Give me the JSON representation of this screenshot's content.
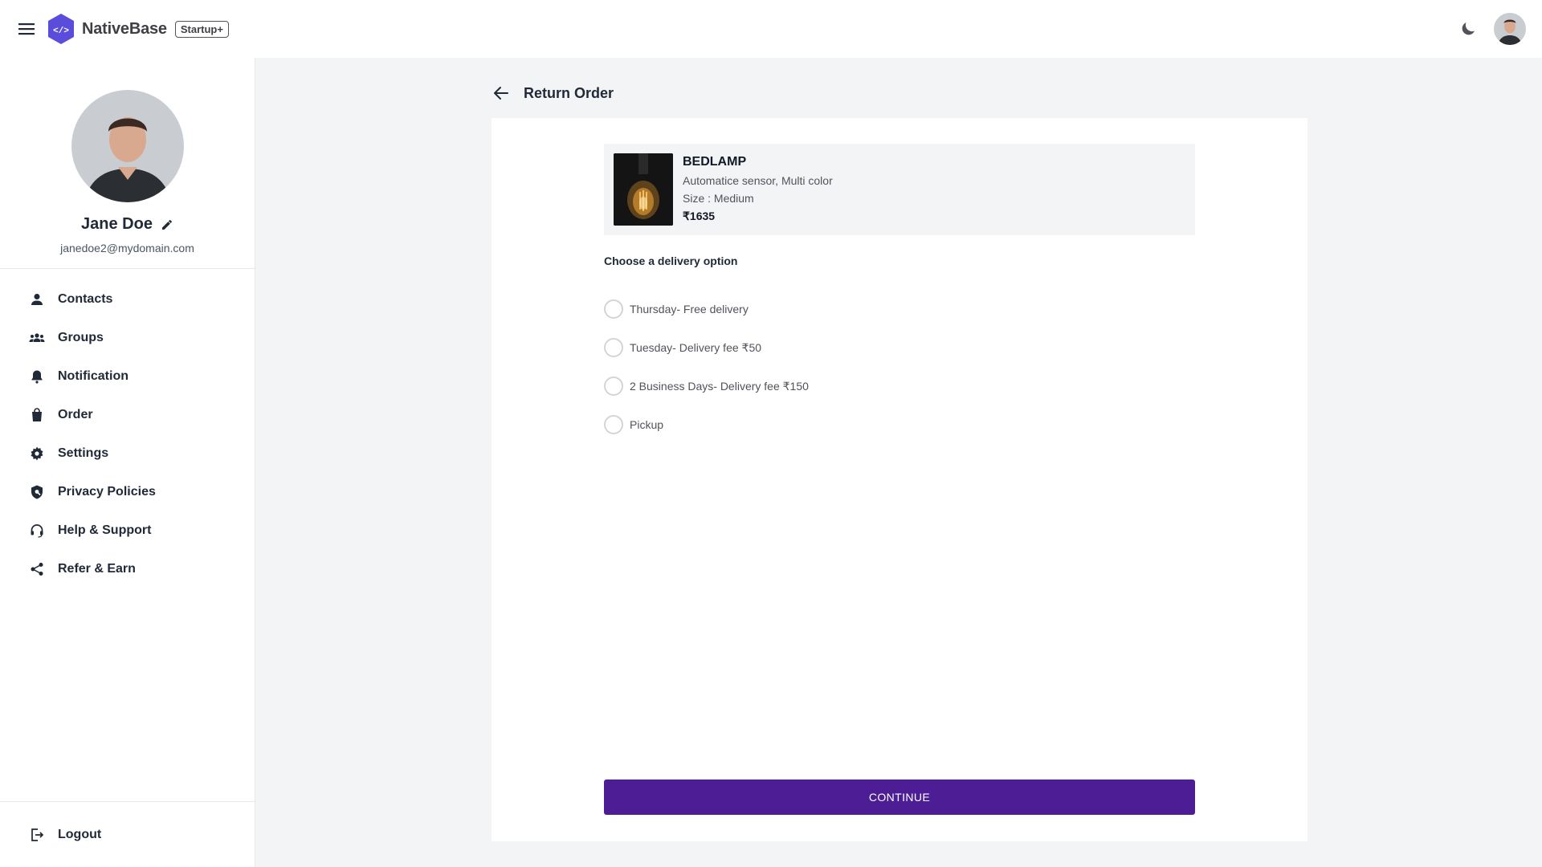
{
  "header": {
    "brand": "NativeBase",
    "badge": "Startup+",
    "icons": [
      "menu-icon",
      "logo-icon",
      "moon-icon",
      "avatar"
    ]
  },
  "profile": {
    "name": "Jane Doe",
    "email": "janedoe2@mydomain.com"
  },
  "sidebar": {
    "items": [
      {
        "label": "Contacts",
        "icon": "person-icon"
      },
      {
        "label": "Groups",
        "icon": "groups-icon"
      },
      {
        "label": "Notification",
        "icon": "bell-icon"
      },
      {
        "label": "Order",
        "icon": "bag-icon"
      },
      {
        "label": "Settings",
        "icon": "gear-icon"
      },
      {
        "label": "Privacy Policies",
        "icon": "shield-icon"
      },
      {
        "label": "Help & Support",
        "icon": "headset-icon"
      },
      {
        "label": "Refer & Earn",
        "icon": "share-icon"
      }
    ],
    "logout": {
      "label": "Logout",
      "icon": "logout-icon"
    }
  },
  "main": {
    "title": "Return Order",
    "product": {
      "name": "BEDLAMP",
      "description": "Automatice sensor, Multi color",
      "size": "Size : Medium",
      "price": "₹1635"
    },
    "delivery_label": "Choose a delivery option",
    "options": [
      "Thursday- Free delivery",
      "Tuesday- Delivery fee ₹50",
      "2 Business Days- Delivery fee ₹150",
      "Pickup"
    ],
    "cta": "CONTINUE"
  },
  "colors": {
    "brand": "#5b4ddb",
    "cta": "#4c1d95",
    "background": "#f3f4f6"
  }
}
